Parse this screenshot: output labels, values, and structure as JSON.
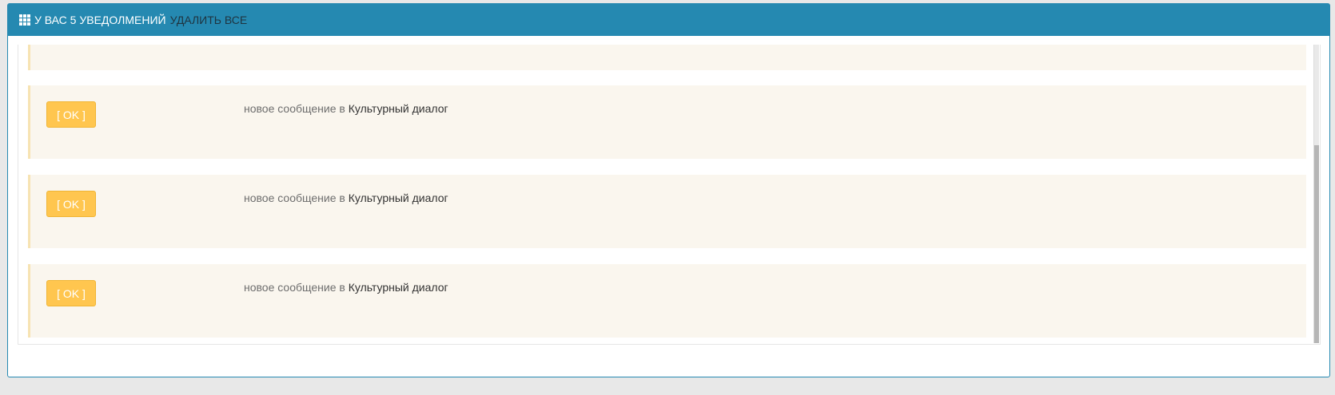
{
  "header": {
    "title": "У ВАС 5 УВЕДОЛМЕНИЙ",
    "delete_all": "УДАЛИТЬ ВСЕ",
    "icon": "grid-icon"
  },
  "notifications": [
    {
      "button_label": "[ OK ]",
      "message_prefix": "новое сообщение в",
      "link_text": "Культурный диалог"
    },
    {
      "button_label": "[ OK ]",
      "message_prefix": "новое сообщение в",
      "link_text": "Культурный диалог"
    },
    {
      "button_label": "[ OK ]",
      "message_prefix": "новое сообщение в",
      "link_text": "Культурный диалог"
    }
  ],
  "colors": {
    "header_bg": "#2589b1",
    "button_bg": "#ffc64f",
    "alert_bg": "#faf6ee",
    "alert_border": "#f7e3b2"
  }
}
